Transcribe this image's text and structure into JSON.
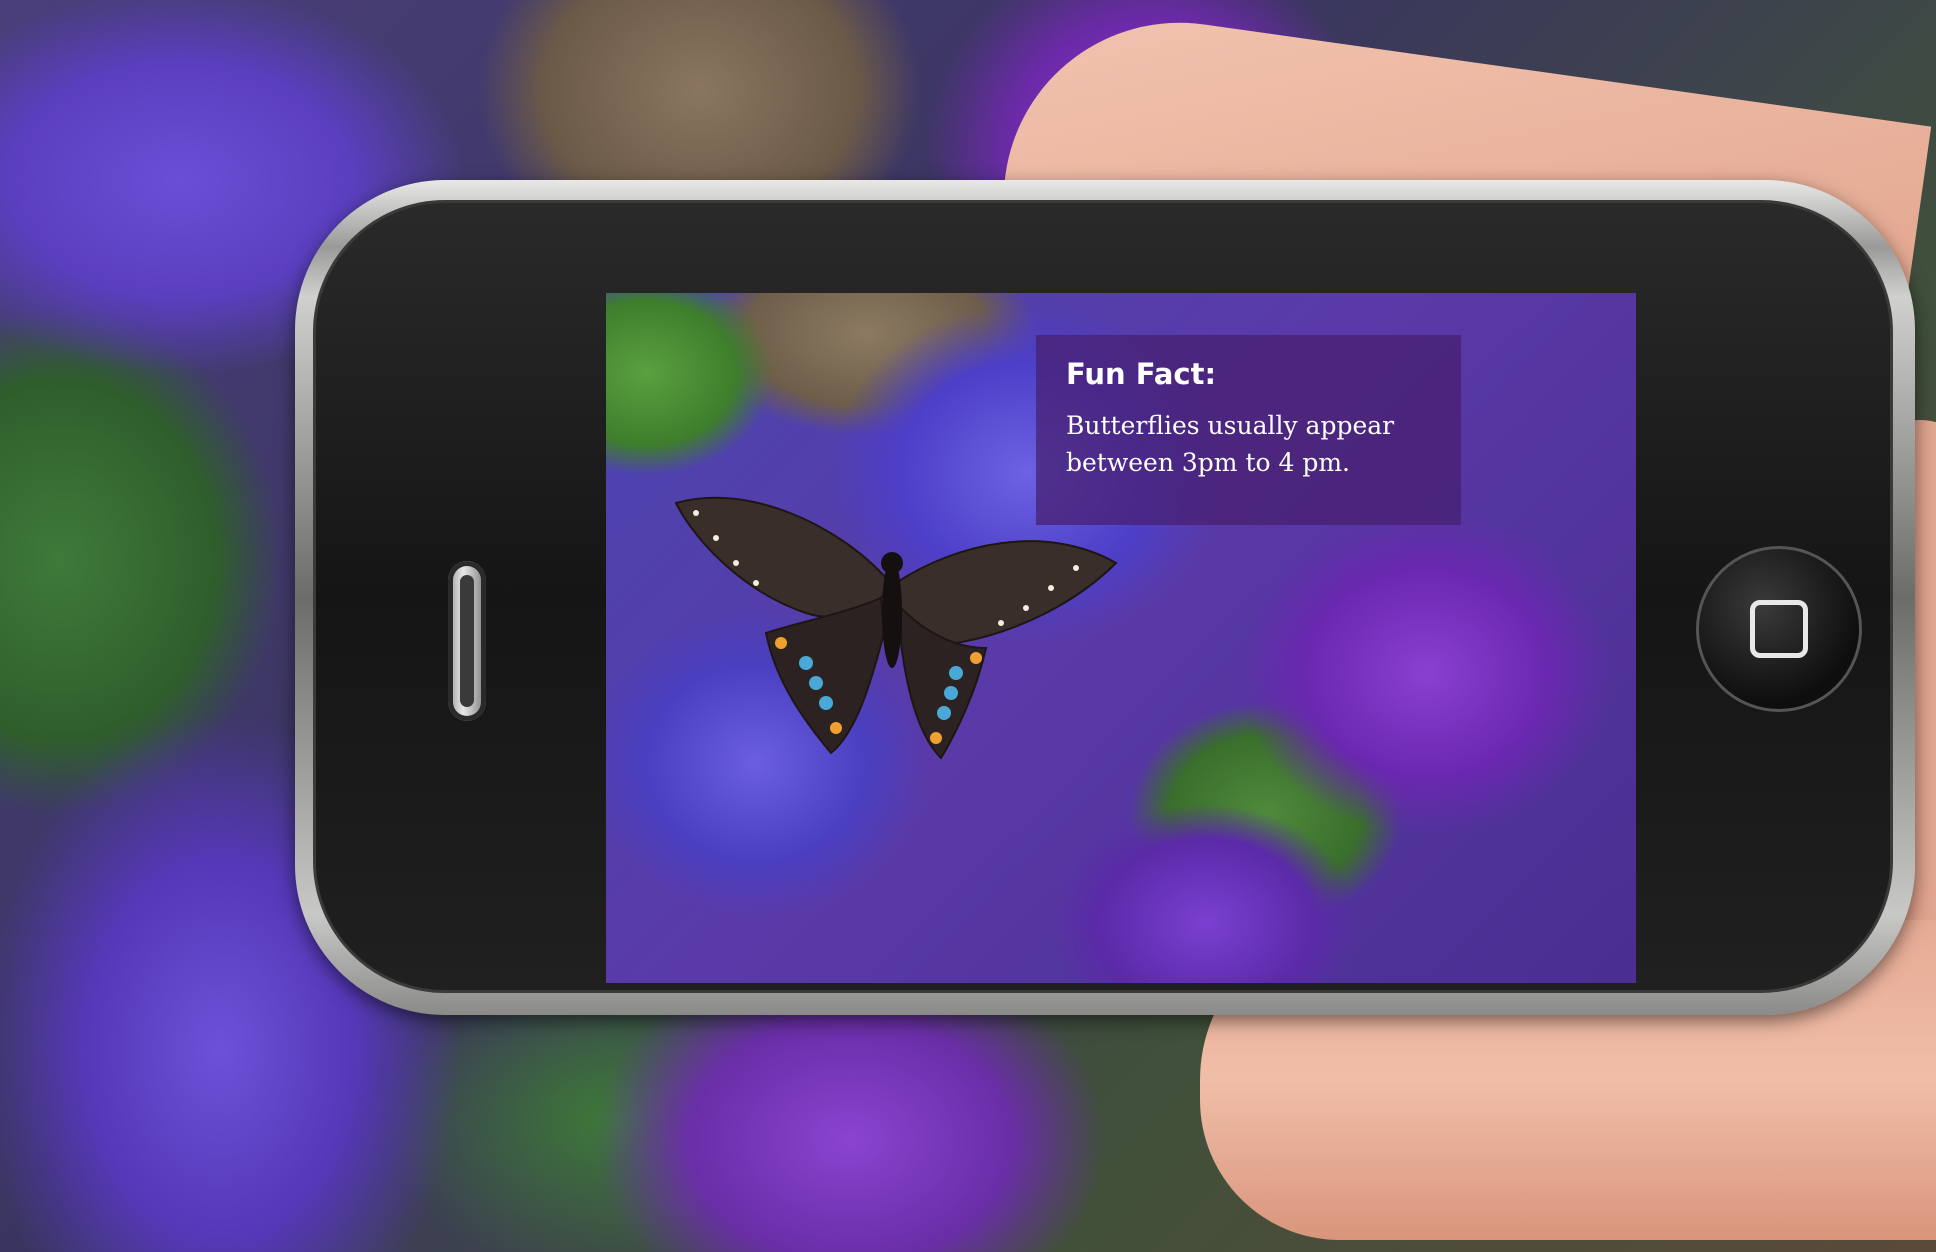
{
  "overlay": {
    "title": "Fun Fact:",
    "body_line_1": "Butterflies usually appear",
    "body_line_2": "between 3pm to 4 pm."
  },
  "colors": {
    "overlay_background": "#46206e",
    "overlay_text": "#ffffff",
    "flowers": "#5a3fbf",
    "leaves": "#3d7a38"
  },
  "icons": {
    "home_button": "home-square-icon",
    "speaker": "earpiece-speaker-icon",
    "butterfly": "butterfly-icon"
  }
}
